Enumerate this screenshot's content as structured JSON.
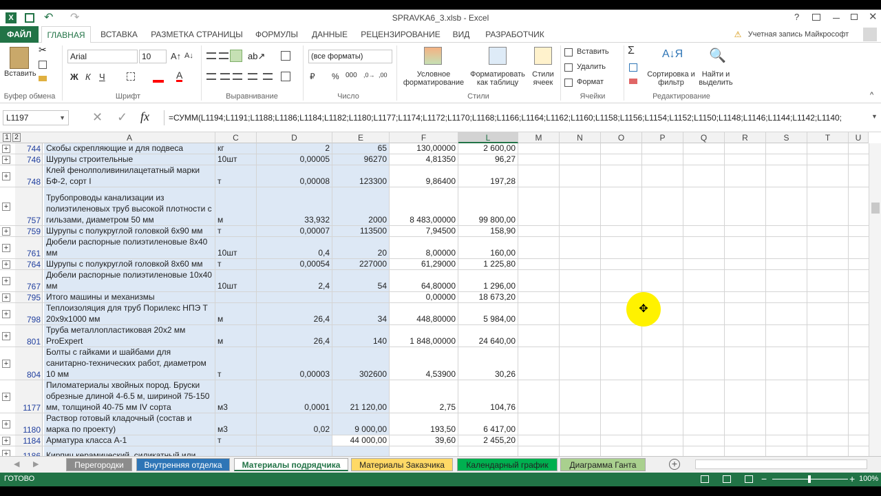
{
  "window": {
    "title": "SPRAVKA6_3.xlsb - Excel",
    "help": "?"
  },
  "tabs": {
    "file": "ФАЙЛ",
    "items": [
      "ГЛАВНАЯ",
      "ВСТАВКА",
      "РАЗМЕТКА СТРАНИЦЫ",
      "ФОРМУЛЫ",
      "ДАННЫЕ",
      "РЕЦЕНЗИРОВАНИЕ",
      "ВИД",
      "РАЗРАБОТЧИК"
    ],
    "account": "Учетная запись Майкрософт"
  },
  "ribbon": {
    "paste": "Вставить",
    "font_name": "Arial",
    "font_size": "10",
    "number_format": "(все форматы)",
    "bold": "Ж",
    "italic": "К",
    "underline": "Ч",
    "cond_format": "Условное форматирование",
    "format_table": "Форматировать как таблицу",
    "cell_styles": "Стили ячеек",
    "insert": "Вставить",
    "delete": "Удалить",
    "format": "Формат",
    "sort_filter": "Сортировка и фильтр",
    "find_select": "Найти и выделить",
    "groups": [
      "Буфер обмена",
      "Шрифт",
      "Выравнивание",
      "Число",
      "Стили",
      "Ячейки",
      "Редактирование"
    ]
  },
  "formula_bar": {
    "name_box": "L1197",
    "fx": "fx",
    "formula": "=СУММ(L1194;L1191;L1188;L1186;L1184;L1182;L1180;L1177;L1174;L1172;L1170;L1168;L1166;L1164;L1162;L1160;L1158;L1156;L1154;L1152;L1150;L1148;L1146;L1144;L1142;L1140;"
  },
  "grid": {
    "outline_levels": [
      "1",
      "2"
    ],
    "columns": [
      "A",
      "C",
      "D",
      "E",
      "F",
      "L",
      "M",
      "N",
      "O",
      "P",
      "Q",
      "R",
      "S",
      "T",
      "U"
    ],
    "rows": [
      {
        "num": "744",
        "a": "Скобы скрепляющие и для подвеса",
        "c": "кг",
        "d": "2",
        "e": "65",
        "f": "130,00000",
        "l": "2 600,00"
      },
      {
        "num": "746",
        "a": "Шурупы строительные",
        "c": "10шт",
        "d": "0,00005",
        "e": "96270",
        "f": "4,81350",
        "l": "96,27"
      },
      {
        "num": "748",
        "a": "Клей фенолполивинилацетатный марки БФ-2, сорт I",
        "c": "т",
        "d": "0,00008",
        "e": "123300",
        "f": "9,86400",
        "l": "197,28"
      },
      {
        "num": "757",
        "a": "Трубопроводы канализации из полиэтиленовых труб высокой плотности с гильзами, диаметром 50 мм",
        "c": "м",
        "d": "33,932",
        "e": "2000",
        "f": "8 483,00000",
        "l": "99 800,00"
      },
      {
        "num": "759",
        "a": "Шурупы с полукруглой головкой 6х90 мм",
        "c": "т",
        "d": "0,00007",
        "e": "113500",
        "f": "7,94500",
        "l": "158,90"
      },
      {
        "num": "761",
        "a": "Дюбели распорные полиэтиленовые 8х40 мм",
        "c": "10шт",
        "d": "0,4",
        "e": "20",
        "f": "8,00000",
        "l": "160,00"
      },
      {
        "num": "764",
        "a": "Шурупы с полукруглой головкой 8х60 мм",
        "c": "т",
        "d": "0,00054",
        "e": "227000",
        "f": "61,29000",
        "l": "1 225,80"
      },
      {
        "num": "767",
        "a": "Дюбели распорные полиэтиленовые 10х40 мм",
        "c": "10шт",
        "d": "2,4",
        "e": "54",
        "f": "64,80000",
        "l": "1 296,00"
      },
      {
        "num": "795",
        "a": "Итого машины и механизмы",
        "c": "",
        "d": "",
        "e": "",
        "f": "0,00000",
        "l": "18 673,20"
      },
      {
        "num": "798",
        "a": "Теплоизоляция для труб Порилекс НПЭ Т 20х9х1000 мм",
        "c": "м",
        "d": "26,4",
        "e": "34",
        "f": "448,80000",
        "l": "5 984,00"
      },
      {
        "num": "801",
        "a": "Труба металлопластиковая 20х2 мм ProExpert",
        "c": "м",
        "d": "26,4",
        "e": "140",
        "f": "1 848,00000",
        "l": "24 640,00"
      },
      {
        "num": "804",
        "a": "Болты с гайками и шайбами для санитарно-технических работ, диаметром 10 мм",
        "c": "т",
        "d": "0,00003",
        "e": "302600",
        "f": "4,53900",
        "l": "30,26"
      },
      {
        "num": "1177",
        "a": "Пиломатериалы хвойных пород. Бруски обрезные длиной 4-6.5 м, шириной 75-150 мм, толщиной 40-75 мм IV сорта",
        "c": "м3",
        "d": "0,0001",
        "e": "21 120,00",
        "f": "2,75",
        "l": "104,76"
      },
      {
        "num": "1180",
        "a": "Раствор готовый кладочный (состав и марка по проекту)",
        "c": "м3",
        "d": "0,02",
        "e": "9 000,00",
        "f": "193,50",
        "l": "6 417,00"
      },
      {
        "num": "1184",
        "a": "Арматура класса А-1",
        "c": "т",
        "d": "",
        "e": "44 000,00",
        "f": "39,60",
        "l": "2 455,20"
      },
      {
        "num": "1186",
        "a": "Кирпич керамический, силикатный или",
        "c": "",
        "d": "",
        "e": "",
        "f": "",
        "l": ""
      }
    ]
  },
  "sheets": [
    "Перегородки",
    "Внутренняя отделка",
    "Материалы подрядчика",
    "Материалы Заказчика",
    "Календарный график",
    "Диаграмма Ганта"
  ],
  "sheet_colors": [
    "#8c8c8c",
    "#2e75b6",
    "#f2f2f2",
    "#ffd966",
    "#00b050",
    "#a9d08e"
  ],
  "status": {
    "mode": "ГОТОВО",
    "zoom": "100%"
  }
}
